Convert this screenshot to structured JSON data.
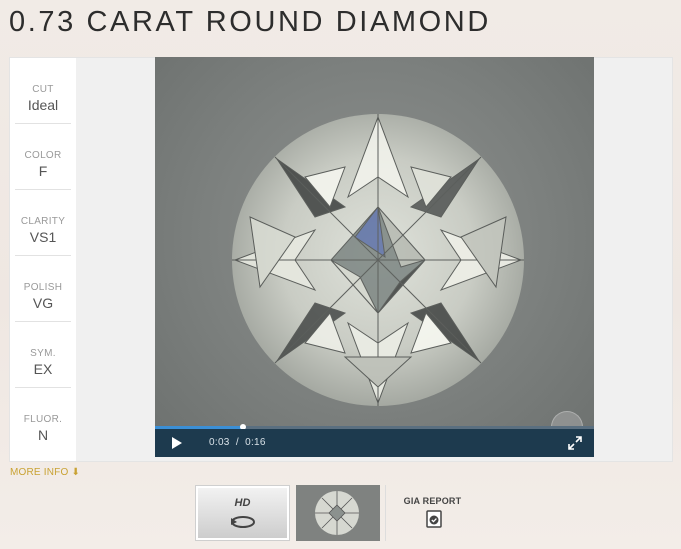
{
  "title": "0.73 CARAT ROUND DIAMOND",
  "specs": [
    {
      "label": "CUT",
      "value": "Ideal"
    },
    {
      "label": "COLOR",
      "value": "F"
    },
    {
      "label": "CLARITY",
      "value": "VS1"
    },
    {
      "label": "POLISH",
      "value": "VG"
    },
    {
      "label": "SYM.",
      "value": "EX"
    },
    {
      "label": "FLUOR.",
      "value": "N"
    }
  ],
  "player": {
    "current_time": "0:03",
    "separator": "/",
    "duration": "0:16",
    "progress": 0.2
  },
  "more_info": "MORE INFO",
  "thumbnails": {
    "hd_label": "HD",
    "gia_label": "GIA REPORT"
  },
  "colors": {
    "accent": "#c9a233",
    "control_bar": "#1d3a4e",
    "progress": "#3b8fd6"
  },
  "icons": [
    "play-icon",
    "fullscreen-icon",
    "rotate-icon",
    "gia-certificate-icon",
    "down-arrow-icon"
  ]
}
